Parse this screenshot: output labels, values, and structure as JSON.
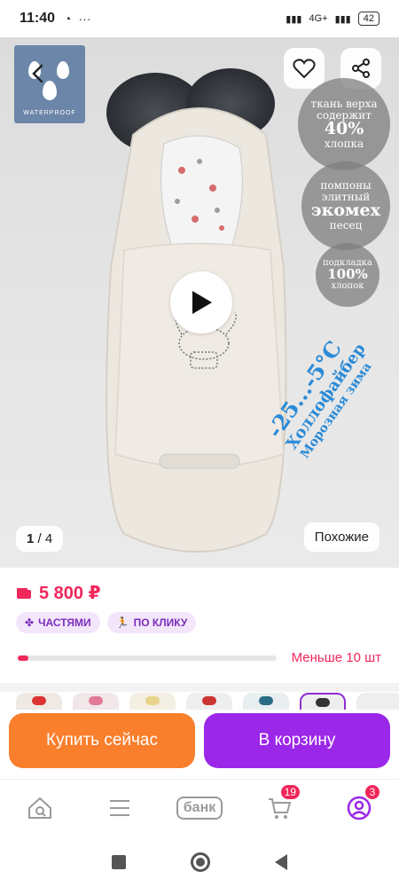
{
  "status_bar": {
    "time": "11:40",
    "network": "4G+",
    "battery": "42"
  },
  "hero": {
    "badge_text": "WATERPROOF",
    "info_circles": [
      {
        "lines": [
          "ткань верха",
          "содержит",
          "40%",
          "хлопка"
        ]
      },
      {
        "lines": [
          "помпоны",
          "элитный",
          "экомех",
          "песец"
        ]
      },
      {
        "lines": [
          "подкладка",
          "100%",
          "хлопок"
        ]
      }
    ],
    "diagonal": {
      "temp": "-25...-5°C",
      "fill": "Холлофайбер",
      "season": "Морозная зима"
    },
    "counter_current": "1",
    "counter_total": "/ 4",
    "similar_label": "Похожие"
  },
  "product": {
    "price": "5 800 ₽",
    "chips": [
      {
        "label": "ЧАСТЯМИ",
        "icon": "installments-icon"
      },
      {
        "label": "ПО КЛИКУ",
        "icon": "running-icon"
      }
    ],
    "stock_progress": 0.04,
    "stock_label": "Меньше 10 шт"
  },
  "actions": {
    "buy_now": "Купить сейчас",
    "add_to_cart": "В корзину"
  },
  "tabbar": {
    "bank_label": "банк",
    "cart_badge": "19",
    "profile_badge": "3"
  },
  "colors": {
    "accent_pink": "#f0275a",
    "buy_orange": "#f97f2c",
    "cart_purple": "#9b27e8"
  }
}
